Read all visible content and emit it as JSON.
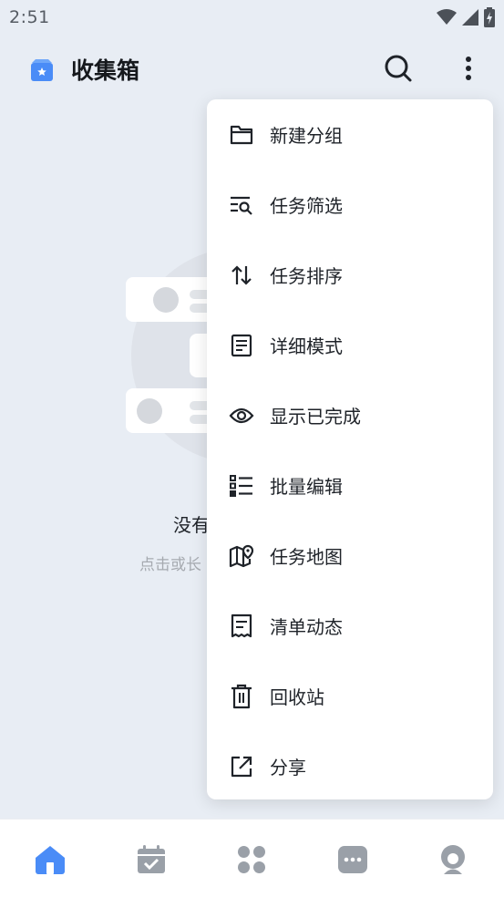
{
  "status_bar": {
    "time": "2:51",
    "icons": [
      "wifi-icon",
      "signal-icon",
      "battery-icon"
    ]
  },
  "app_bar": {
    "title": "收集箱",
    "icons": [
      "inbox-icon",
      "search-icon",
      "more-vert-icon"
    ]
  },
  "empty_state": {
    "title": "没有",
    "hint": "点击或长"
  },
  "menu": {
    "items": [
      {
        "label": "新建分组",
        "icon": "folder-icon"
      },
      {
        "label": "任务筛选",
        "icon": "filter-search-icon"
      },
      {
        "label": "任务排序",
        "icon": "sort-icon"
      },
      {
        "label": "详细模式",
        "icon": "document-icon"
      },
      {
        "label": "显示已完成",
        "icon": "eye-icon"
      },
      {
        "label": "批量编辑",
        "icon": "checklist-icon"
      },
      {
        "label": "任务地图",
        "icon": "map-pin-icon"
      },
      {
        "label": "清单动态",
        "icon": "receipt-icon"
      },
      {
        "label": "回收站",
        "icon": "trash-icon"
      },
      {
        "label": "分享",
        "icon": "share-icon"
      }
    ]
  },
  "bottom_nav": {
    "items": [
      {
        "icon": "home-icon",
        "active": true
      },
      {
        "icon": "calendar-icon",
        "active": false
      },
      {
        "icon": "apps-icon",
        "active": false
      },
      {
        "icon": "chat-icon",
        "active": false
      },
      {
        "icon": "profile-icon",
        "active": false
      }
    ]
  },
  "colors": {
    "accent": "#4a8cf7",
    "background": "#e8edf4",
    "menu_bg": "#ffffff",
    "icon_gray": "#9aa0a8"
  }
}
